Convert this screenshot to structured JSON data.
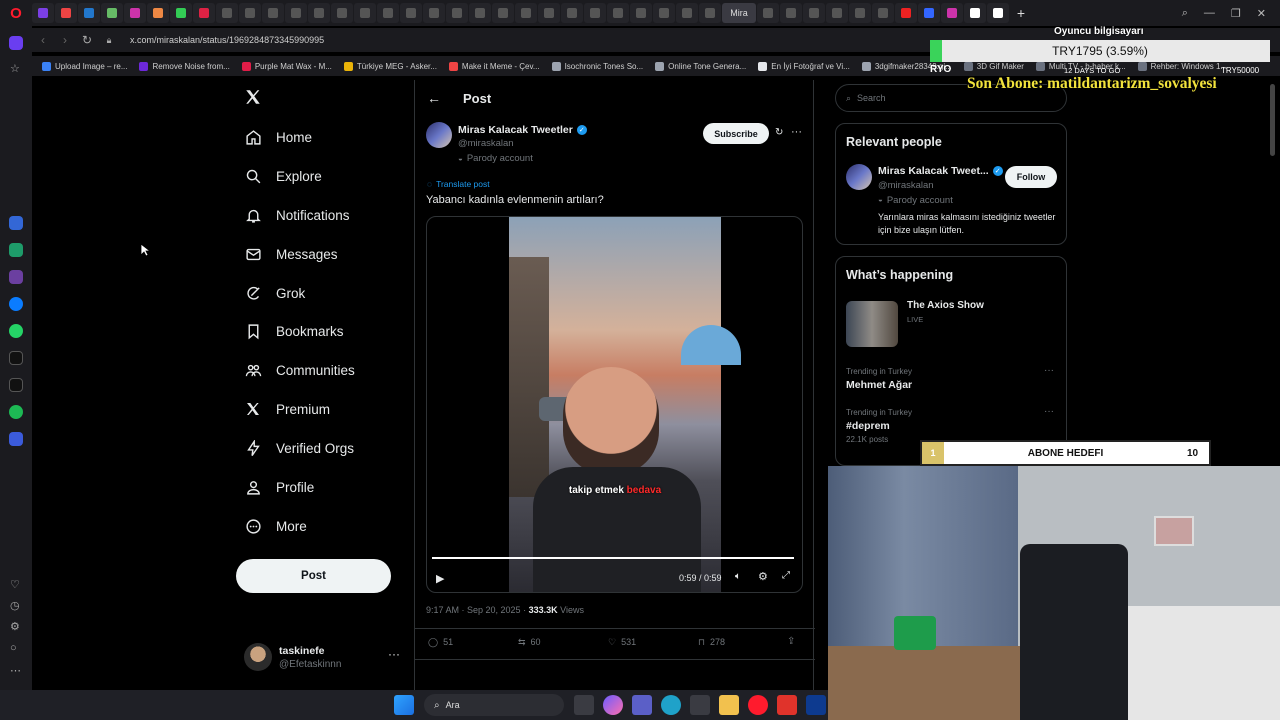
{
  "browser": {
    "url": "x.com/miraskalan/status/1969284873345990995",
    "active_tab_label": "Mira",
    "bookmarks": [
      "Upload Image – re...",
      "Remove Noise from...",
      "Purple Mat Wax - M...",
      "Türkiye MEG - Asker...",
      "Make it Meme - Çev...",
      "Isochronic Tones So...",
      "Online Tone Genera...",
      "En İyi Fotoğraf ve Vi...",
      "3dgifmaker28349.gi...",
      "3D Gif Maker",
      "Multi TV - b-haber k...",
      "Rehber: Windows 1..."
    ]
  },
  "nav": {
    "items": [
      {
        "label": "Home",
        "icon": "home-icon"
      },
      {
        "label": "Explore",
        "icon": "search-icon"
      },
      {
        "label": "Notifications",
        "icon": "bell-icon"
      },
      {
        "label": "Messages",
        "icon": "envelope-icon"
      },
      {
        "label": "Grok",
        "icon": "grok-icon"
      },
      {
        "label": "Bookmarks",
        "icon": "bookmark-icon"
      },
      {
        "label": "Communities",
        "icon": "people-icon"
      },
      {
        "label": "Premium",
        "icon": "x-logo-icon"
      },
      {
        "label": "Verified Orgs",
        "icon": "lightning-icon"
      },
      {
        "label": "Profile",
        "icon": "person-icon"
      },
      {
        "label": "More",
        "icon": "more-circle-icon"
      }
    ],
    "post_button": "Post",
    "user": {
      "name": "taskinefe",
      "handle": "@Efetaskinnn"
    }
  },
  "main": {
    "header_title": "Post",
    "author_name": "Miras Kalacak Tweetler",
    "author_handle": "@miraskalan",
    "author_badge": "Parody account",
    "subscribe_label": "Subscribe",
    "translate_label": "Translate post",
    "tweet_text": "Yabancı kadınla evlenmenin artıları?",
    "video": {
      "caption_white": "takip etmek",
      "caption_red": "bedava",
      "time": "0:59 / 0:59",
      "progress": 1.0
    },
    "meta_time": "9:17 AM · Sep 20, 2025 · ",
    "views_count": "333.3K",
    "views_label": " Views",
    "stats": {
      "replies": "51",
      "reposts": "60",
      "likes": "531",
      "bookmarks": "278"
    }
  },
  "right": {
    "search_placeholder": "Search",
    "relevant_title": "Relevant people",
    "relevant_person": {
      "name": "Miras Kalacak Tweet...",
      "handle": "@miraskalan",
      "badge": "Parody account",
      "bio": "Yarınlara miras kalmasını istediğiniz tweetler için bize ulaşın lütfen.",
      "follow_label": "Follow"
    },
    "happening_title": "What’s happening",
    "show": {
      "title": "The Axios Show",
      "status": "LIVE"
    },
    "trends": [
      {
        "context": "Trending in Turkey",
        "name": "Mehmet Ağar",
        "posts": ""
      },
      {
        "context": "Trending in Turkey",
        "name": "#deprem",
        "posts": "22.1K posts"
      }
    ]
  },
  "overlay": {
    "donation_title": "Oyuncu bilgisayarı",
    "donation_amount": "TRY1795 (3.59%)",
    "donation_left": "RYO",
    "donation_days": "12 DAYS TO GO",
    "donation_goal": "TRY50000",
    "last_sub": "Son Abone: matildantarizm_sovalyesi",
    "sub_goal": {
      "current": "1",
      "label": "ABONE HEDEFI",
      "target": "10"
    }
  },
  "taskbar": {
    "search_label": "Ara"
  },
  "colors": {
    "accent": "#1d9bf0",
    "verified": "#1d9bf0",
    "bg": "#000000",
    "border": "#2f3336",
    "overlay_text": "#f2e33c",
    "opera_red": "#ff1b2d"
  }
}
